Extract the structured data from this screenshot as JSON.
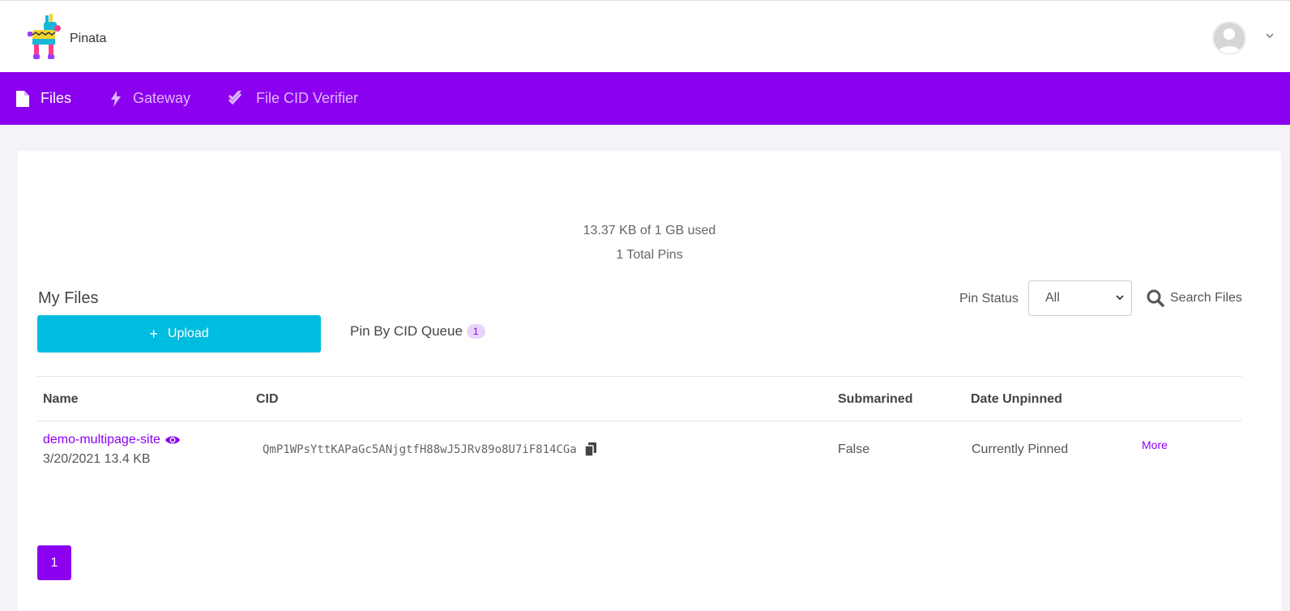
{
  "app": {
    "brand": "Pinata"
  },
  "nav": {
    "items": [
      {
        "label": "Files",
        "icon": "file-icon",
        "active": true
      },
      {
        "label": "Gateway",
        "icon": "bolt-icon",
        "active": false
      },
      {
        "label": "File CID Verifier",
        "icon": "double-check-icon",
        "active": false
      }
    ]
  },
  "usage": {
    "storage": "13.37 KB of 1 GB used",
    "pins": "1 Total Pins"
  },
  "files": {
    "title": "My Files",
    "upload_label": "Upload",
    "queue_label": "Pin By CID Queue",
    "queue_count": "1",
    "pin_status_label": "Pin Status",
    "pin_status_value": "All",
    "search_label": "Search Files"
  },
  "table": {
    "headers": [
      "Name",
      "CID",
      "Submarined",
      "Date Unpinned"
    ],
    "rows": [
      {
        "name": "demo-multipage-site",
        "meta": "3/20/2021 13.4 KB",
        "cid": "QmP1WPsYttKAPaGc5ANjgtfH88wJ5JRv89o8U7iF814CGa",
        "submarined": "False",
        "date_unpinned": "Currently Pinned",
        "more_label": "More"
      }
    ]
  },
  "pagination": {
    "current": "1"
  },
  "colors": {
    "brand": "#8c00f0",
    "upload": "#00bde0"
  }
}
